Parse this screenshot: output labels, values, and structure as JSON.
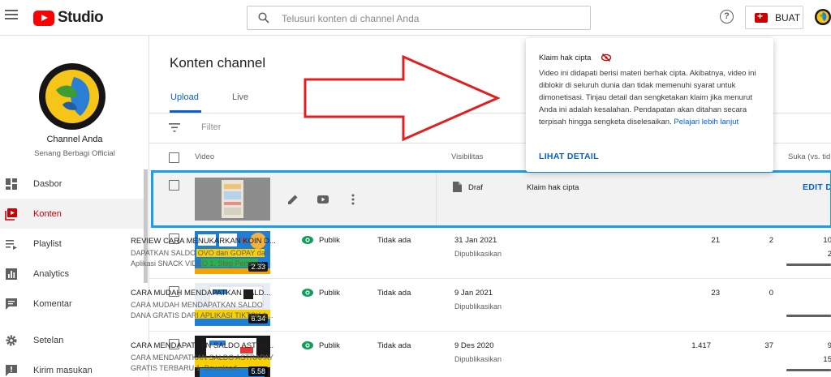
{
  "header": {
    "logo_text": "Studio",
    "search_placeholder": "Telusuri konten di channel Anda",
    "help_symbol": "?",
    "create_label": "BUAT"
  },
  "sidebar": {
    "channel_name": "Channel Anda",
    "channel_subtitle": "Senang Berbagi Official",
    "items": [
      {
        "label": "Dasbor",
        "icon": "dashboard-icon"
      },
      {
        "label": "Konten",
        "icon": "content-icon",
        "active": true
      },
      {
        "label": "Playlist",
        "icon": "playlist-icon"
      },
      {
        "label": "Analytics",
        "icon": "analytics-icon"
      },
      {
        "label": "Komentar",
        "icon": "comments-icon"
      },
      {
        "label": "Setelan",
        "icon": "settings-icon"
      },
      {
        "label": "Kirim masukan",
        "icon": "feedback-icon"
      }
    ]
  },
  "main": {
    "title": "Konten channel",
    "tabs": [
      "Upload",
      "Live"
    ],
    "filter_placeholder": "Filter",
    "columns": {
      "video": "Video",
      "visibility": "Visibilitas",
      "likes": "Suka (vs. tid"
    }
  },
  "draft_row": {
    "visibility": "Draf",
    "restriction": "Klaim hak cipta",
    "action": "EDIT DRAF"
  },
  "rows": [
    {
      "title": "REVIEW CARA MENUKARKAN KOIN D...",
      "desc": "DAPATKAN SALDO OVO dan GOPAY dari Aplikasi SNACK VIDEO 1. Step Pertama...",
      "duration": "2.33",
      "visibility": "Publik",
      "restriction": "Tidak ada",
      "date": "31 Jan 2021",
      "date_sub": "Dipublikasikan",
      "views": "21",
      "comments": "2",
      "likes": "10",
      "likes_sub": "2"
    },
    {
      "title": "CARA MUDAH MENDAPATKAN SALD...",
      "desc": "CARA MUDAH MENDAPATKAN SALDO DANA GRATIS DARI APLIKASI TIKTOK 1...",
      "duration": "6.34",
      "visibility": "Publik",
      "restriction": "Tidak ada",
      "date": "9 Jan 2021",
      "date_sub": "Dipublikasikan",
      "views": "23",
      "comments": "0",
      "likes": "",
      "likes_sub": ""
    },
    {
      "title": "CARA MENDAPATKAN SALDO ASTRA...",
      "desc": "CARA MENDAPATKAN SALDO ASTRAPAY GRATIS TERBARU 1. Download...",
      "duration": "5.58",
      "visibility": "Publik",
      "restriction": "Tidak ada",
      "date": "9 Des 2020",
      "date_sub": "Dipublikasikan",
      "views": "1.417",
      "comments": "37",
      "likes": "9",
      "likes_sub": "15"
    }
  ],
  "tooltip": {
    "title": "Klaim hak cipta",
    "body": "Video ini didapati berisi materi berhak cipta. Akibatnya, video ini diblokir di seluruh dunia dan tidak memenuhi syarat untuk dimonetisasi. Tinjau detail dan sengketakan klaim jika menurut Anda ini adalah kesalahan. Pendapatan akan ditahan secara terpisah hingga sengketa diselesaikan.",
    "link": "Pelajari lebih lanjut",
    "button": "LIHAT DETAIL"
  },
  "colors": {
    "brand_red": "#ff0000",
    "active_red": "#cc0000",
    "link_blue": "#065fd4",
    "highlight_blue": "#1a9fe0",
    "public_green": "#0f9d58"
  }
}
